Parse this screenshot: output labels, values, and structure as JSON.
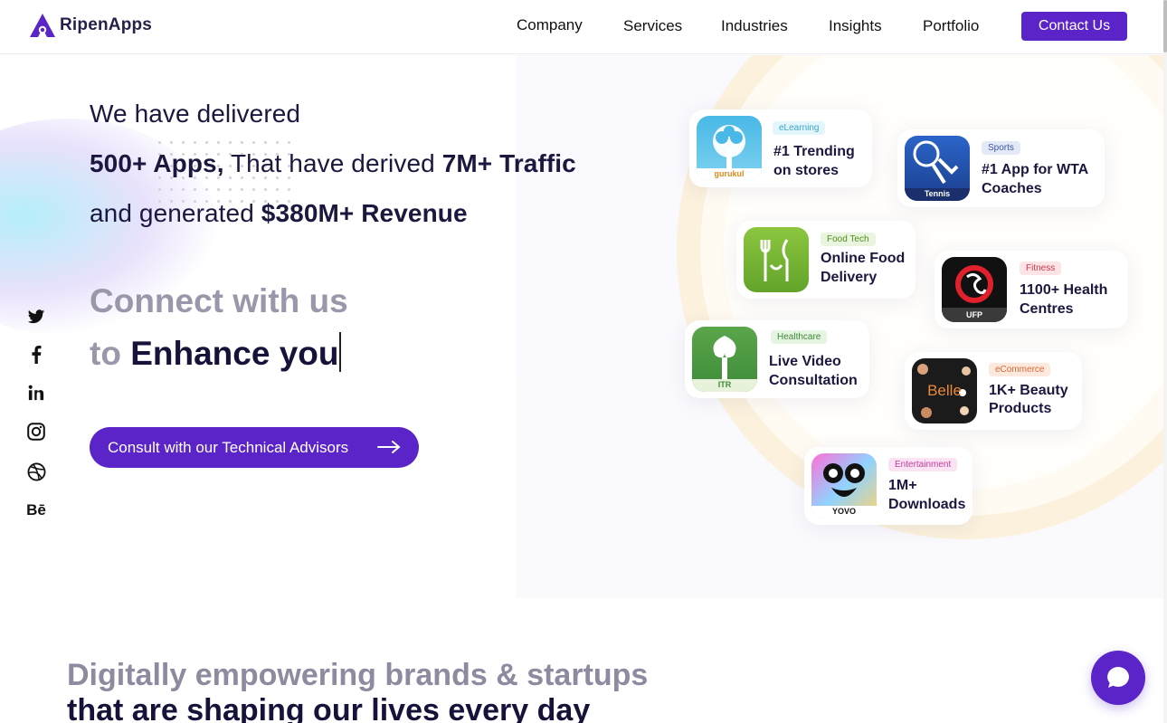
{
  "header": {
    "brand": "RipenApps",
    "nav": [
      "Company",
      "Services",
      "Industries",
      "Insights",
      "Portfolio"
    ],
    "contact_label": "Contact Us"
  },
  "hero": {
    "line1": "We have delivered",
    "line2_bold1": "500+ Apps,",
    "line2_mid": " That have derived ",
    "line2_bold2": "7M+ Traffic",
    "line3_pre": "and generated ",
    "line3_bold": "$380M+ Revenue",
    "connect": "Connect with us",
    "to": "to ",
    "enhance": "Enhance you",
    "cta_label": "Consult with our Technical Advisors"
  },
  "social": [
    "twitter-icon",
    "facebook-icon",
    "linkedin-icon",
    "instagram-icon",
    "dribbble-icon",
    "behance-icon"
  ],
  "social_behance_text": "Bē",
  "cards": [
    {
      "tag": "eLearning",
      "title1": "#1 Trending",
      "title2": "on stores",
      "icon_text": "gurukul"
    },
    {
      "tag": "Sports",
      "title1": "#1 App for WTA",
      "title2": "Coaches",
      "icon_text": "Tennis"
    },
    {
      "tag": "Food Tech",
      "title1": "Online Food",
      "title2": "Delivery",
      "icon_text": ""
    },
    {
      "tag": "Fitness",
      "title1": "1100+ Health",
      "title2": "Centres",
      "icon_text": "UFP"
    },
    {
      "tag": "Healthcare",
      "title1": "Live Video",
      "title2": "Consultation",
      "icon_text": "ITR"
    },
    {
      "tag": "eCommerce",
      "title1": "1K+ Beauty",
      "title2": "Products",
      "icon_text": "Belle"
    },
    {
      "tag": "Entertainment",
      "title1": "1M+",
      "title2": "Downloads",
      "icon_text": "YOVO"
    }
  ],
  "bottom": {
    "line1": "Digitally empowering brands & startups",
    "line2": "that are shaping our lives every day"
  },
  "colors": {
    "accent": "#5b24c9",
    "text_dark": "#16133a",
    "text_gray": "#9a97aa"
  }
}
